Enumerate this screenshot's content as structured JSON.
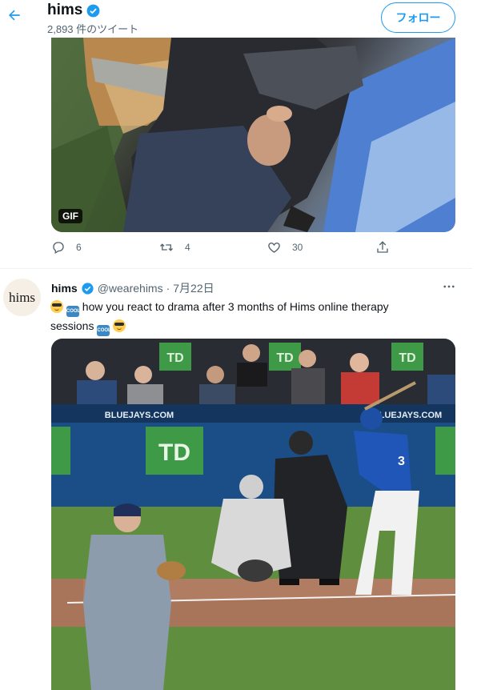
{
  "header": {
    "title": "hims",
    "tweet_count": "2,893 件のツイート",
    "follow_label": "フォロー"
  },
  "tweet1": {
    "media_badge": "GIF",
    "replies": "6",
    "retweets": "4",
    "likes": "30"
  },
  "tweet2": {
    "avatar_text": "hims",
    "name": "hims",
    "handle": "@wearehims",
    "separator": "·",
    "date": "7月22日",
    "text_main": "how you react to drama after 3 months of Hims online therapy",
    "text_end": "sessions",
    "cool_emoji_text": "COOL",
    "media": {
      "banner": "BLUEJAYS.COM",
      "sponsor": "TD",
      "jersey_number": "3"
    }
  },
  "colors": {
    "accent": "#1d9bf0",
    "secondary_text": "#536471",
    "divider": "#eff3f4"
  },
  "icons": [
    "back-arrow-icon",
    "verified-badge-icon",
    "reply-icon",
    "retweet-icon",
    "like-icon",
    "share-icon",
    "more-icon"
  ]
}
